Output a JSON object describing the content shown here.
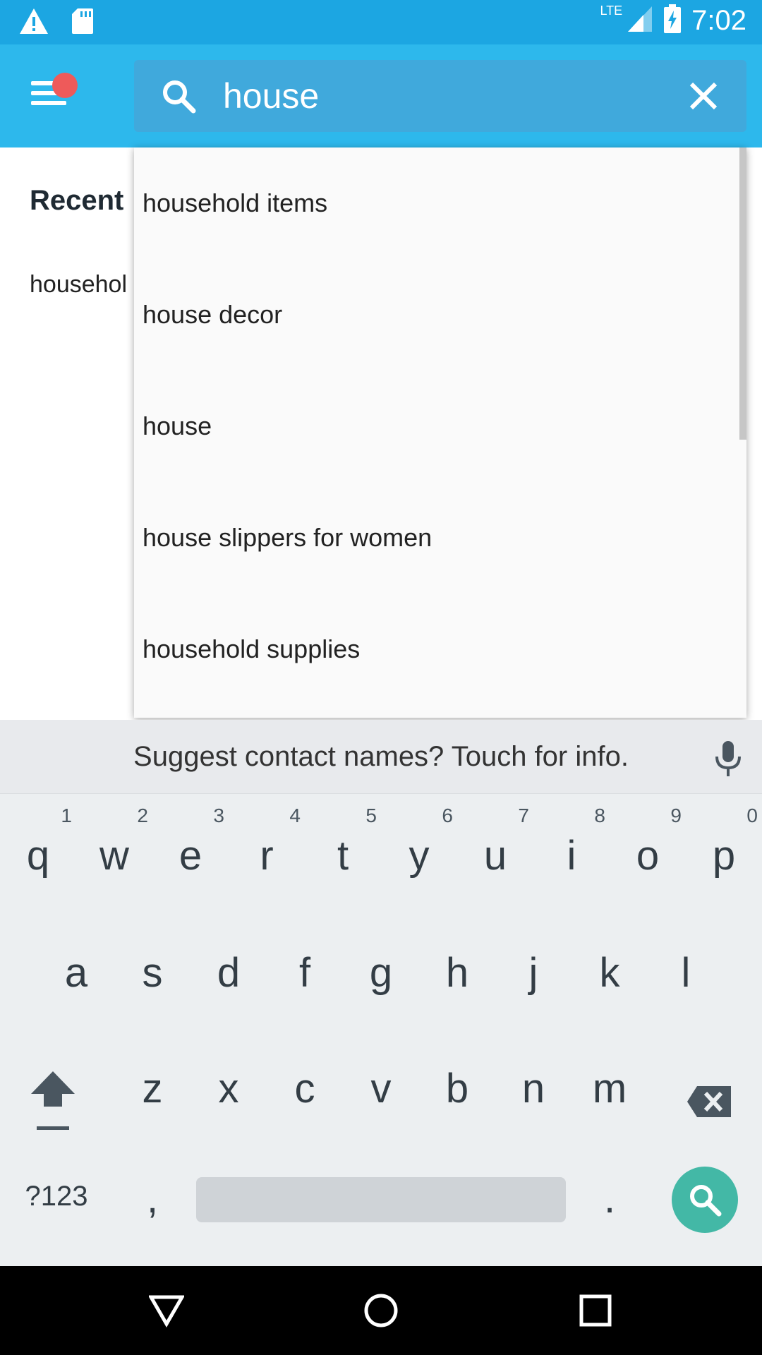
{
  "status_bar": {
    "time": "7:02",
    "network": "LTE",
    "icons": [
      "warning-icon",
      "sd-card-icon",
      "signal-icon",
      "battery-charging-icon"
    ]
  },
  "app_bar": {
    "search_value": "house",
    "search_placeholder": "",
    "icons": [
      "menu-icon",
      "search-icon",
      "close-icon"
    ],
    "notification_dot_color": "#ee5a5a"
  },
  "background": {
    "recent_title": "Recent",
    "recent_item": "househol"
  },
  "suggestions": [
    "household items",
    "house decor",
    "house",
    "house slippers for women",
    "household supplies"
  ],
  "keyboard": {
    "suggestion_strip": "Suggest contact names? Touch for info.",
    "row1": [
      {
        "key": "q",
        "hint": "1"
      },
      {
        "key": "w",
        "hint": "2"
      },
      {
        "key": "e",
        "hint": "3"
      },
      {
        "key": "r",
        "hint": "4"
      },
      {
        "key": "t",
        "hint": "5"
      },
      {
        "key": "y",
        "hint": "6"
      },
      {
        "key": "u",
        "hint": "7"
      },
      {
        "key": "i",
        "hint": "8"
      },
      {
        "key": "o",
        "hint": "9"
      },
      {
        "key": "p",
        "hint": "0"
      }
    ],
    "row2": [
      "a",
      "s",
      "d",
      "f",
      "g",
      "h",
      "j",
      "k",
      "l"
    ],
    "row3": [
      "z",
      "x",
      "c",
      "v",
      "b",
      "n",
      "m"
    ],
    "symbols_key": "?123",
    "comma_key": ",",
    "period_key": ".",
    "action_color": "#43b8a6"
  },
  "colors": {
    "status_bar": "#1ca6e2",
    "app_bar": "#2db8ec",
    "search_box": "#40a9dc"
  }
}
